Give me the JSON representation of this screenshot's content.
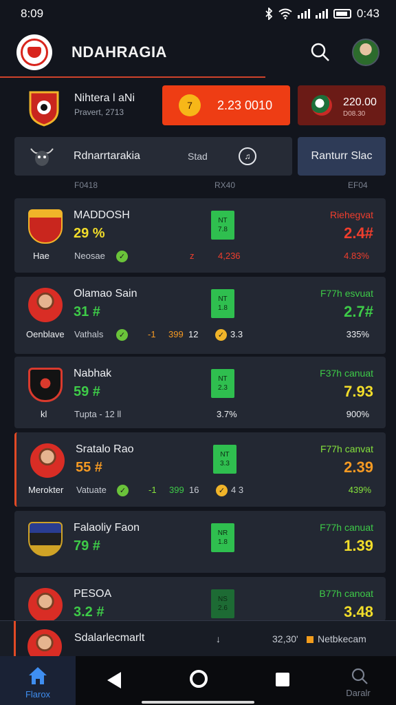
{
  "status": {
    "time": "8:09",
    "clock": "0:43"
  },
  "header": {
    "title": "NDAHRAGIA"
  },
  "hero": {
    "name": "Nihtera l aNi",
    "sub": "Pravert, 2713",
    "live_badge": "7",
    "live_score": "2.23 0010",
    "odds_main": "220.00",
    "odds_sub": "D08.30"
  },
  "filter": {
    "label": "Rdnarrtarakia",
    "stat": "Stad",
    "icon_glyph": "♫",
    "action_label": "Ranturr Slac"
  },
  "columns": [
    "F0418",
    "RX40",
    "EF04"
  ],
  "rows": [
    {
      "name": "MADDOSH",
      "pct": "29 %",
      "pct_color": "#f2dd2a",
      "tag_top": "NT",
      "tag_bottom": "7.8",
      "right_label": "Riehegvat",
      "right_label_color": "#ef3e2d",
      "right_value": "2.4#",
      "right_value_color": "#ef3e2d",
      "foot": [
        "Hae",
        "Neosae",
        "z",
        "4,236",
        "4.83%"
      ]
    },
    {
      "name": "Olamao Sain",
      "pct": "31 #",
      "pct_color": "#3ecb48",
      "tag_top": "NT",
      "tag_bottom": "1.8",
      "right_label": "F77h esvuat",
      "right_label_color": "#3ecb48",
      "right_value": "2.7#",
      "right_value_color": "#3ecb48",
      "foot": [
        "Oenblave",
        "Vathals",
        "-1",
        "399",
        "12",
        "3.3",
        "335%"
      ]
    },
    {
      "name": "Nabhak",
      "pct": "59 #",
      "pct_color": "#3ecb48",
      "tag_top": "NT",
      "tag_bottom": "2.3",
      "right_label": "F37h canuat",
      "right_label_color": "#3ecb48",
      "right_value": "7.93",
      "right_value_color": "#f2dd2a",
      "foot": [
        "kl",
        "Tupta - 12 ll",
        "3.7%",
        "900%"
      ]
    },
    {
      "name": "Sratalo Rao",
      "pct": "55 #",
      "pct_color": "#f59a23",
      "tag_top": "NT",
      "tag_bottom": "3.3",
      "right_label": "F77h canvat",
      "right_label_color": "#86e33c",
      "right_value": "2.39",
      "right_value_color": "#f59a23",
      "foot": [
        "Merokter",
        "Vatuate",
        "-1",
        "399",
        "16",
        "4 3",
        "439%"
      ]
    },
    {
      "name": "Falaoliy Faon",
      "pct": "79 #",
      "pct_color": "#3ecb48",
      "tag_top": "NR",
      "tag_bottom": "1.8",
      "right_label": "F77h canuat",
      "right_label_color": "#3ecb48",
      "right_value": "1.39",
      "right_value_color": "#f2dd2a",
      "foot": []
    },
    {
      "name": "PESOA",
      "pct": "3.2 #",
      "pct_color": "#3ecb48",
      "tag_top": "NS",
      "tag_bottom": "2.6",
      "right_label": "B77h canoat",
      "right_label_color": "#3ecb48",
      "right_value": "3.48",
      "right_value_color": "#f2dd2a",
      "foot": []
    }
  ],
  "sticky": {
    "name": "Sdalarlecmarlt",
    "arrow": "↓",
    "time": "32,30'",
    "label": "Netbkecam"
  },
  "bottom_nav": {
    "home_label": "Flarox",
    "search_label": "Daralr"
  }
}
